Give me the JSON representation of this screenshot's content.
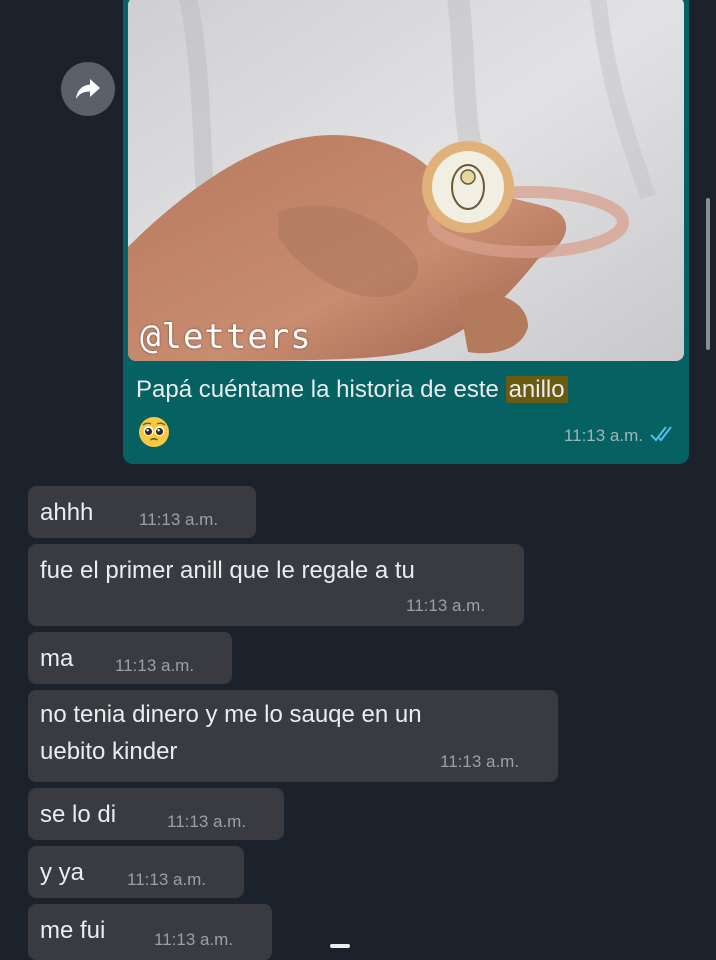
{
  "outgoing_message": {
    "image_watermark": "@letters",
    "caption_before": "Papá cuéntame la historia de este ",
    "caption_highlight": "anillo",
    "emoji": "pleading-face-emoji",
    "time": "11:13 a.m.",
    "status": "read-double-check-icon"
  },
  "incoming_messages": [
    {
      "text": "ahhh",
      "time": "11:13 a.m."
    },
    {
      "text": "fue el primer anill que le regale a tu",
      "time": "11:13 a.m."
    },
    {
      "text": "ma",
      "time": "11:13 a.m."
    },
    {
      "text": "no tenia dinero y me lo sauqe en un\nuebito kinder",
      "line1": "no tenia dinero y me lo sauqe en un",
      "line2": "uebito kinder",
      "time": "11:13 a.m."
    },
    {
      "text": "se lo di",
      "time": "11:13 a.m."
    },
    {
      "text": "y ya",
      "time": "11:13 a.m."
    },
    {
      "text": "me fui",
      "time": "11:13 a.m."
    }
  ],
  "colors": {
    "background": "#1b222c",
    "outgoing_bubble": "#056162",
    "incoming_bubble": "#393b40",
    "highlight": "#6b5a12",
    "read_ticks": "#53bdeb"
  }
}
